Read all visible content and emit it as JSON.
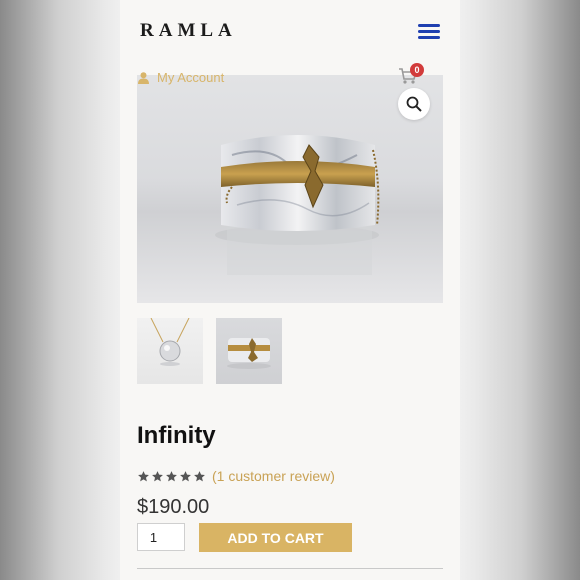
{
  "header": {
    "logo": "RAMLA",
    "account_label": "My Account",
    "cart_count": "0"
  },
  "product": {
    "name": "Infinity",
    "rating": 5,
    "review_link": "(1 customer review)",
    "price": "$190.00",
    "quantity": "1",
    "add_to_cart_label": "ADD TO CART"
  },
  "colors": {
    "accent_gold": "#d9b464",
    "menu_blue": "#1f3fb0",
    "badge_red": "#d23b3b"
  },
  "icons": {
    "menu": "hamburger-icon",
    "account": "user-icon",
    "cart": "cart-icon",
    "zoom": "magnifier-icon",
    "stars": "star-icon"
  }
}
